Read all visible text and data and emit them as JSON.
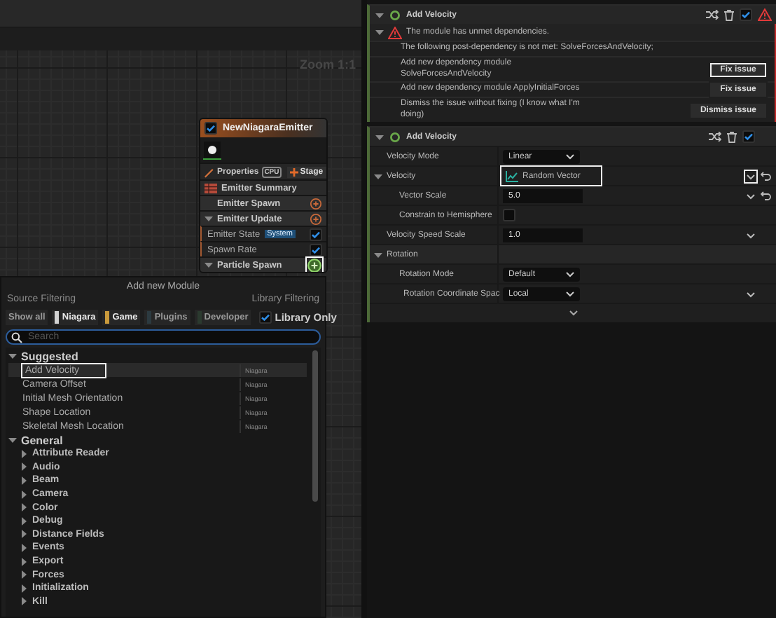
{
  "graph": {
    "zoom_label": "Zoom 1:1"
  },
  "emitter_node": {
    "title": "NewNiagaraEmitter",
    "enabled": true,
    "properties": "Properties",
    "sim_target": "CPU",
    "stage_button": "Stage",
    "rows": [
      {
        "kind": "summary",
        "label": "Emitter Summary"
      },
      {
        "kind": "group",
        "label": "Emitter Spawn",
        "expanded": false,
        "highlighted": false
      },
      {
        "kind": "group",
        "label": "Emitter Update",
        "expanded": true,
        "highlighted": false
      },
      {
        "kind": "module",
        "label": "Emitter State",
        "tag": "System",
        "checked": true
      },
      {
        "kind": "module",
        "label": "Spawn Rate",
        "checked": true
      },
      {
        "kind": "group",
        "label": "Particle Spawn",
        "expanded": true,
        "highlighted": true
      }
    ]
  },
  "module_picker": {
    "title": "Add new Module",
    "source_filtering": "Source Filtering",
    "library_filtering": "Library Filtering",
    "show_all": "Show all",
    "sources": [
      {
        "label": "Niagara",
        "on": true,
        "color": "#d2d2d2"
      },
      {
        "label": "Game",
        "on": true,
        "color": "#c99a3c"
      },
      {
        "label": "Plugins",
        "on": false,
        "color": "#2c3a40"
      },
      {
        "label": "Developer",
        "on": false,
        "color": "#2b3a2f"
      }
    ],
    "library_only": {
      "label": "Library Only",
      "checked": true
    },
    "search": {
      "placeholder": "Search"
    },
    "categories": [
      {
        "label": "Suggested",
        "expanded": true,
        "items": [
          {
            "name": "Add Velocity",
            "source": "Niagara",
            "selected": true,
            "highlighted": true
          },
          {
            "name": "Camera Offset",
            "source": "Niagara",
            "selected": false,
            "highlighted": false
          },
          {
            "name": "Initial Mesh Orientation",
            "source": "Niagara",
            "selected": false,
            "highlighted": false
          },
          {
            "name": "Shape Location",
            "source": "Niagara",
            "selected": false,
            "highlighted": false
          },
          {
            "name": "Skeletal Mesh Location",
            "source": "Niagara",
            "selected": false,
            "highlighted": false
          }
        ]
      },
      {
        "label": "General",
        "expanded": true,
        "children": [
          {
            "label": "Attribute Reader",
            "expanded": false
          },
          {
            "label": "Audio",
            "expanded": false
          },
          {
            "label": "Beam",
            "expanded": false
          },
          {
            "label": "Camera",
            "expanded": false
          },
          {
            "label": "Color",
            "expanded": false
          },
          {
            "label": "Debug",
            "expanded": false
          },
          {
            "label": "Distance Fields",
            "expanded": false
          },
          {
            "label": "Events",
            "expanded": false
          },
          {
            "label": "Export",
            "expanded": false
          },
          {
            "label": "Forces",
            "expanded": false
          },
          {
            "label": "Initialization",
            "expanded": false
          },
          {
            "label": "Kill",
            "expanded": false
          }
        ]
      }
    ]
  },
  "module_stack": [
    {
      "title": "Add Velocity",
      "enabled": true,
      "has_warning": true,
      "issues": {
        "message": "The module has unmet dependencies.",
        "expanded": true,
        "rows": [
          {
            "text": "The following post-dependency is not met: SolveForcesAndVelocity;"
          },
          {
            "text": "Add new dependency module SolveForcesAndVelocity",
            "action": "Fix issue",
            "highlighted": true
          },
          {
            "text": "Add new dependency module ApplyInitialForces",
            "action": "Fix issue",
            "highlighted": false
          },
          {
            "text": "Dismiss the issue without fixing (I know what I'm doing)",
            "action": "Dismiss issue",
            "highlighted": false
          }
        ]
      }
    },
    {
      "title": "Add Velocity",
      "enabled": true,
      "has_warning": false,
      "parameters": [
        {
          "kind": "dropdown",
          "label": "Velocity Mode",
          "value": "Linear",
          "menu": false,
          "reset": false
        },
        {
          "kind": "dynamic",
          "label": "Velocity",
          "value": "Random Vector",
          "highlighted": true,
          "expanded": true,
          "menu": true,
          "menu_highlighted": true,
          "reset": true,
          "children": [
            {
              "kind": "number",
              "label": "Vector Scale",
              "value": "5.0",
              "menu": true,
              "menu_highlighted": false,
              "reset": true
            },
            {
              "kind": "checkbox",
              "label": "Constrain to Hemisphere",
              "checked": false,
              "menu": false,
              "reset": false
            }
          ]
        },
        {
          "kind": "number",
          "label": "Velocity Speed Scale",
          "value": "1.0",
          "menu": true,
          "menu_highlighted": false,
          "reset": false
        },
        {
          "kind": "category",
          "label": "Rotation",
          "expanded": true,
          "menu": false,
          "reset": false,
          "children": [
            {
              "kind": "dropdown",
              "label": "Rotation Mode",
              "value": "Default",
              "menu": false,
              "reset": false,
              "children": [
                {
                  "kind": "dropdown",
                  "label": "Rotation Coordinate Spac",
                  "value": "Local",
                  "menu": true,
                  "menu_highlighted": false,
                  "reset": false
                }
              ]
            }
          ]
        }
      ]
    }
  ]
}
